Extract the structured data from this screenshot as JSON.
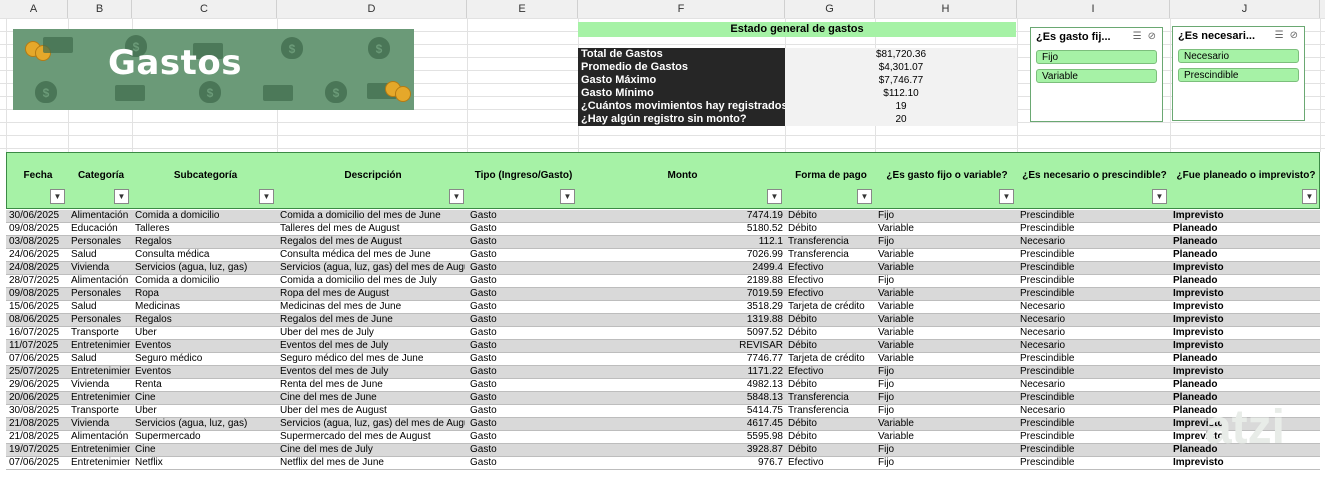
{
  "columns": [
    "A",
    "B",
    "C",
    "D",
    "E",
    "F",
    "G",
    "H",
    "I",
    "J"
  ],
  "banner": {
    "title": "Gastos"
  },
  "summary": {
    "header": "Estado general de gastos",
    "items": [
      {
        "label": "Total de Gastos",
        "value": "$81,720.36"
      },
      {
        "label": "Promedio de Gastos",
        "value": "$4,301.07"
      },
      {
        "label": "Gasto Máximo",
        "value": "$7,746.77"
      },
      {
        "label": "Gasto Mínimo",
        "value": "$112.10"
      },
      {
        "label": "¿Cuántos movimientos hay registrados?",
        "value": "19"
      },
      {
        "label": "¿Hay algún registro sin monto?",
        "value": "20"
      }
    ]
  },
  "slicers": [
    {
      "title": "¿Es gasto fij...",
      "items": [
        "Fijo",
        "Variable"
      ]
    },
    {
      "title": "¿Es necesari...",
      "items": [
        "Necesario",
        "Prescindible"
      ]
    }
  ],
  "table": {
    "headers": [
      "Fecha",
      "Categoría",
      "Subcategoría",
      "Descripción",
      "Tipo (Ingreso/Gasto)",
      "Monto",
      "Forma de pago",
      "¿Es gasto fijo o variable?",
      "¿Es necesario o prescindible?",
      "¿Fue planeado o imprevisto?"
    ],
    "rows": [
      [
        "30/06/2025",
        "Alimentación",
        "Comida a domicilio",
        "Comida a domicilio del mes de June",
        "Gasto",
        "7474.19",
        "Débito",
        "Fijo",
        "Prescindible",
        "Imprevisto"
      ],
      [
        "09/08/2025",
        "Educación",
        "Talleres",
        "Talleres del mes de August",
        "Gasto",
        "5180.52",
        "Débito",
        "Variable",
        "Prescindible",
        "Planeado"
      ],
      [
        "03/08/2025",
        "Personales",
        "Regalos",
        "Regalos del mes de August",
        "Gasto",
        "112.1",
        "Transferencia",
        "Fijo",
        "Necesario",
        "Planeado"
      ],
      [
        "24/06/2025",
        "Salud",
        "Consulta médica",
        "Consulta médica del mes de June",
        "Gasto",
        "7026.99",
        "Transferencia",
        "Variable",
        "Prescindible",
        "Planeado"
      ],
      [
        "24/08/2025",
        "Vivienda",
        "Servicios (agua, luz, gas)",
        "Servicios (agua, luz, gas) del mes de August",
        "Gasto",
        "2499.4",
        "Efectivo",
        "Variable",
        "Prescindible",
        "Imprevisto"
      ],
      [
        "28/07/2025",
        "Alimentación",
        "Comida a domicilio",
        "Comida a domicilio del mes de July",
        "Gasto",
        "2189.88",
        "Efectivo",
        "Fijo",
        "Prescindible",
        "Planeado"
      ],
      [
        "09/08/2025",
        "Personales",
        "Ropa",
        "Ropa del mes de August",
        "Gasto",
        "7019.59",
        "Efectivo",
        "Variable",
        "Prescindible",
        "Imprevisto"
      ],
      [
        "15/06/2025",
        "Salud",
        "Medicinas",
        "Medicinas del mes de June",
        "Gasto",
        "3518.29",
        "Tarjeta de crédito",
        "Variable",
        "Necesario",
        "Imprevisto"
      ],
      [
        "08/06/2025",
        "Personales",
        "Regalos",
        "Regalos del mes de June",
        "Gasto",
        "1319.88",
        "Débito",
        "Variable",
        "Necesario",
        "Imprevisto"
      ],
      [
        "16/07/2025",
        "Transporte",
        "Uber",
        "Uber del mes de July",
        "Gasto",
        "5097.52",
        "Débito",
        "Variable",
        "Necesario",
        "Imprevisto"
      ],
      [
        "11/07/2025",
        "Entretenimiento",
        "Eventos",
        "Eventos del mes de July",
        "Gasto",
        "REVISAR",
        "Débito",
        "Variable",
        "Necesario",
        "Imprevisto"
      ],
      [
        "07/06/2025",
        "Salud",
        "Seguro médico",
        "Seguro médico del mes de June",
        "Gasto",
        "7746.77",
        "Tarjeta de crédito",
        "Variable",
        "Prescindible",
        "Planeado"
      ],
      [
        "25/07/2025",
        "Entretenimiento",
        "Eventos",
        "Eventos del mes de July",
        "Gasto",
        "1171.22",
        "Efectivo",
        "Fijo",
        "Prescindible",
        "Imprevisto"
      ],
      [
        "29/06/2025",
        "Vivienda",
        "Renta",
        "Renta del mes de June",
        "Gasto",
        "4982.13",
        "Débito",
        "Fijo",
        "Necesario",
        "Planeado"
      ],
      [
        "20/06/2025",
        "Entretenimiento",
        "Cine",
        "Cine del mes de June",
        "Gasto",
        "5848.13",
        "Transferencia",
        "Fijo",
        "Prescindible",
        "Planeado"
      ],
      [
        "30/08/2025",
        "Transporte",
        "Uber",
        "Uber del mes de August",
        "Gasto",
        "5414.75",
        "Transferencia",
        "Fijo",
        "Necesario",
        "Planeado"
      ],
      [
        "21/08/2025",
        "Vivienda",
        "Servicios (agua, luz, gas)",
        "Servicios (agua, luz, gas) del mes de August",
        "Gasto",
        "4617.45",
        "Débito",
        "Variable",
        "Prescindible",
        "Imprevisto"
      ],
      [
        "21/08/2025",
        "Alimentación",
        "Supermercado",
        "Supermercado del mes de August",
        "Gasto",
        "5595.98",
        "Débito",
        "Variable",
        "Prescindible",
        "Imprevisto"
      ],
      [
        "19/07/2025",
        "Entretenimiento",
        "Cine",
        "Cine del mes de July",
        "Gasto",
        "3928.87",
        "Débito",
        "Fijo",
        "Prescindible",
        "Planeado"
      ],
      [
        "07/06/2025",
        "Entretenimiento",
        "Netflix",
        "Netflix del mes de June",
        "Gasto",
        "976.7",
        "Efectivo",
        "Fijo",
        "Prescindible",
        "Imprevisto"
      ]
    ]
  },
  "colors": {
    "header_green": "#a6f2a6",
    "banner_green": "#6b9a78",
    "summary_dark": "#262626",
    "row_shade": "#d9d9d9"
  },
  "icons": [
    "money-bag-icon",
    "banknote-icon",
    "coin-stack-icon",
    "filter-dropdown-icon",
    "multi-select-icon",
    "clear-filter-icon"
  ]
}
